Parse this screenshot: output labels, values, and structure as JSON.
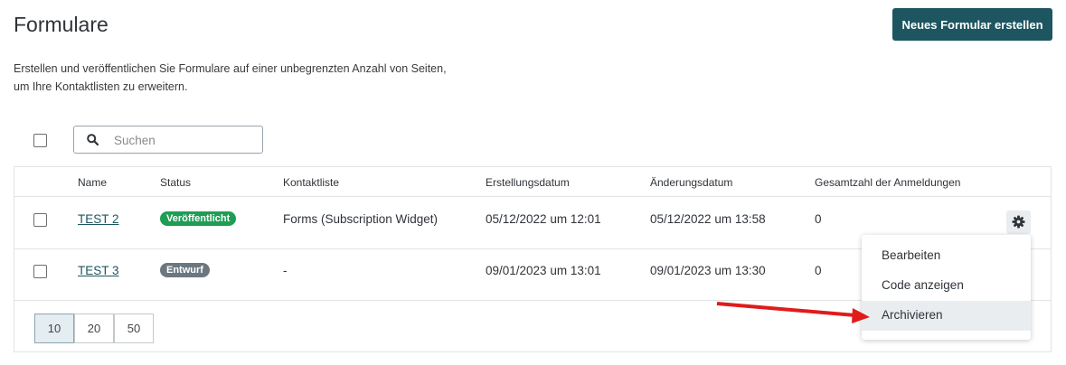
{
  "page": {
    "title": "Formulare",
    "create_button": "Neues Formular erstellen",
    "intro_line1": "Erstellen und veröffentlichen Sie Formulare auf einer unbegrenzten Anzahl von Seiten,",
    "intro_line2": "um Ihre Kontaktlisten zu erweitern."
  },
  "search": {
    "placeholder": "Suchen"
  },
  "table": {
    "headers": [
      "Name",
      "Status",
      "Kontaktliste",
      "Erstellungsdatum",
      "Änderungsdatum",
      "Gesamtzahl der Anmeldungen"
    ],
    "rows": [
      {
        "name": "TEST 2",
        "status": "Veröffentlicht",
        "status_color": "#1f9d55",
        "contact_list": "Forms (Subscription Widget)",
        "created": "05/12/2022 um 12:01",
        "modified": "05/12/2022 um 13:58",
        "signups": "0"
      },
      {
        "name": "TEST 3",
        "status": "Entwurf",
        "status_color": "#6b7780",
        "contact_list": "-",
        "created": "09/01/2023 um 13:01",
        "modified": "09/01/2023 um 13:30",
        "signups": "0"
      }
    ]
  },
  "pagination": {
    "sizes": [
      "10",
      "20",
      "50"
    ],
    "selected": "10"
  },
  "context_menu": {
    "items": [
      "Bearbeiten",
      "Code anzeigen",
      "Archivieren"
    ],
    "highlighted": "Archivieren"
  },
  "colors": {
    "primary": "#1d5560",
    "annotation_arrow": "#e01b1b"
  }
}
